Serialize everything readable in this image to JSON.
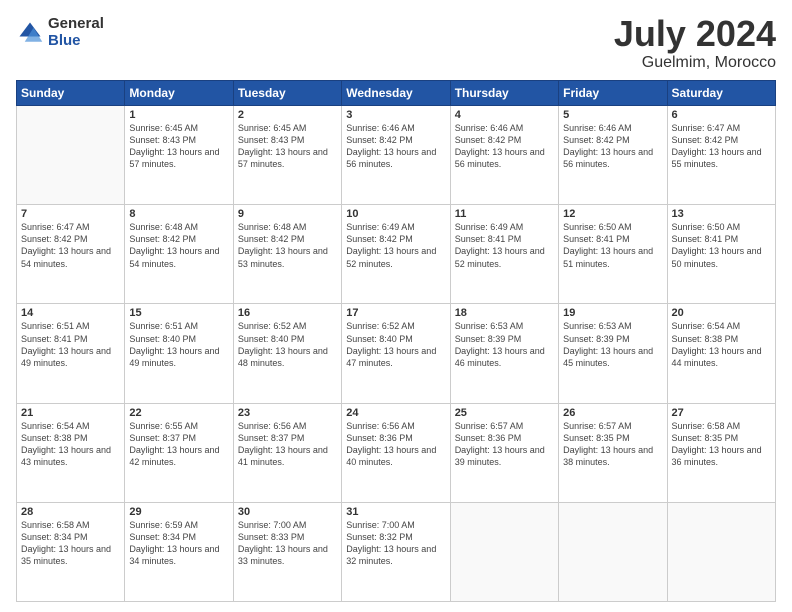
{
  "logo": {
    "general": "General",
    "blue": "Blue"
  },
  "title": {
    "month_year": "July 2024",
    "location": "Guelmim, Morocco"
  },
  "weekdays": [
    "Sunday",
    "Monday",
    "Tuesday",
    "Wednesday",
    "Thursday",
    "Friday",
    "Saturday"
  ],
  "weeks": [
    [
      {
        "day": "",
        "sunrise": "",
        "sunset": "",
        "daylight": ""
      },
      {
        "day": "1",
        "sunrise": "Sunrise: 6:45 AM",
        "sunset": "Sunset: 8:43 PM",
        "daylight": "Daylight: 13 hours and 57 minutes."
      },
      {
        "day": "2",
        "sunrise": "Sunrise: 6:45 AM",
        "sunset": "Sunset: 8:43 PM",
        "daylight": "Daylight: 13 hours and 57 minutes."
      },
      {
        "day": "3",
        "sunrise": "Sunrise: 6:46 AM",
        "sunset": "Sunset: 8:42 PM",
        "daylight": "Daylight: 13 hours and 56 minutes."
      },
      {
        "day": "4",
        "sunrise": "Sunrise: 6:46 AM",
        "sunset": "Sunset: 8:42 PM",
        "daylight": "Daylight: 13 hours and 56 minutes."
      },
      {
        "day": "5",
        "sunrise": "Sunrise: 6:46 AM",
        "sunset": "Sunset: 8:42 PM",
        "daylight": "Daylight: 13 hours and 56 minutes."
      },
      {
        "day": "6",
        "sunrise": "Sunrise: 6:47 AM",
        "sunset": "Sunset: 8:42 PM",
        "daylight": "Daylight: 13 hours and 55 minutes."
      }
    ],
    [
      {
        "day": "7",
        "sunrise": "Sunrise: 6:47 AM",
        "sunset": "Sunset: 8:42 PM",
        "daylight": "Daylight: 13 hours and 54 minutes."
      },
      {
        "day": "8",
        "sunrise": "Sunrise: 6:48 AM",
        "sunset": "Sunset: 8:42 PM",
        "daylight": "Daylight: 13 hours and 54 minutes."
      },
      {
        "day": "9",
        "sunrise": "Sunrise: 6:48 AM",
        "sunset": "Sunset: 8:42 PM",
        "daylight": "Daylight: 13 hours and 53 minutes."
      },
      {
        "day": "10",
        "sunrise": "Sunrise: 6:49 AM",
        "sunset": "Sunset: 8:42 PM",
        "daylight": "Daylight: 13 hours and 52 minutes."
      },
      {
        "day": "11",
        "sunrise": "Sunrise: 6:49 AM",
        "sunset": "Sunset: 8:41 PM",
        "daylight": "Daylight: 13 hours and 52 minutes."
      },
      {
        "day": "12",
        "sunrise": "Sunrise: 6:50 AM",
        "sunset": "Sunset: 8:41 PM",
        "daylight": "Daylight: 13 hours and 51 minutes."
      },
      {
        "day": "13",
        "sunrise": "Sunrise: 6:50 AM",
        "sunset": "Sunset: 8:41 PM",
        "daylight": "Daylight: 13 hours and 50 minutes."
      }
    ],
    [
      {
        "day": "14",
        "sunrise": "Sunrise: 6:51 AM",
        "sunset": "Sunset: 8:41 PM",
        "daylight": "Daylight: 13 hours and 49 minutes."
      },
      {
        "day": "15",
        "sunrise": "Sunrise: 6:51 AM",
        "sunset": "Sunset: 8:40 PM",
        "daylight": "Daylight: 13 hours and 49 minutes."
      },
      {
        "day": "16",
        "sunrise": "Sunrise: 6:52 AM",
        "sunset": "Sunset: 8:40 PM",
        "daylight": "Daylight: 13 hours and 48 minutes."
      },
      {
        "day": "17",
        "sunrise": "Sunrise: 6:52 AM",
        "sunset": "Sunset: 8:40 PM",
        "daylight": "Daylight: 13 hours and 47 minutes."
      },
      {
        "day": "18",
        "sunrise": "Sunrise: 6:53 AM",
        "sunset": "Sunset: 8:39 PM",
        "daylight": "Daylight: 13 hours and 46 minutes."
      },
      {
        "day": "19",
        "sunrise": "Sunrise: 6:53 AM",
        "sunset": "Sunset: 8:39 PM",
        "daylight": "Daylight: 13 hours and 45 minutes."
      },
      {
        "day": "20",
        "sunrise": "Sunrise: 6:54 AM",
        "sunset": "Sunset: 8:38 PM",
        "daylight": "Daylight: 13 hours and 44 minutes."
      }
    ],
    [
      {
        "day": "21",
        "sunrise": "Sunrise: 6:54 AM",
        "sunset": "Sunset: 8:38 PM",
        "daylight": "Daylight: 13 hours and 43 minutes."
      },
      {
        "day": "22",
        "sunrise": "Sunrise: 6:55 AM",
        "sunset": "Sunset: 8:37 PM",
        "daylight": "Daylight: 13 hours and 42 minutes."
      },
      {
        "day": "23",
        "sunrise": "Sunrise: 6:56 AM",
        "sunset": "Sunset: 8:37 PM",
        "daylight": "Daylight: 13 hours and 41 minutes."
      },
      {
        "day": "24",
        "sunrise": "Sunrise: 6:56 AM",
        "sunset": "Sunset: 8:36 PM",
        "daylight": "Daylight: 13 hours and 40 minutes."
      },
      {
        "day": "25",
        "sunrise": "Sunrise: 6:57 AM",
        "sunset": "Sunset: 8:36 PM",
        "daylight": "Daylight: 13 hours and 39 minutes."
      },
      {
        "day": "26",
        "sunrise": "Sunrise: 6:57 AM",
        "sunset": "Sunset: 8:35 PM",
        "daylight": "Daylight: 13 hours and 38 minutes."
      },
      {
        "day": "27",
        "sunrise": "Sunrise: 6:58 AM",
        "sunset": "Sunset: 8:35 PM",
        "daylight": "Daylight: 13 hours and 36 minutes."
      }
    ],
    [
      {
        "day": "28",
        "sunrise": "Sunrise: 6:58 AM",
        "sunset": "Sunset: 8:34 PM",
        "daylight": "Daylight: 13 hours and 35 minutes."
      },
      {
        "day": "29",
        "sunrise": "Sunrise: 6:59 AM",
        "sunset": "Sunset: 8:34 PM",
        "daylight": "Daylight: 13 hours and 34 minutes."
      },
      {
        "day": "30",
        "sunrise": "Sunrise: 7:00 AM",
        "sunset": "Sunset: 8:33 PM",
        "daylight": "Daylight: 13 hours and 33 minutes."
      },
      {
        "day": "31",
        "sunrise": "Sunrise: 7:00 AM",
        "sunset": "Sunset: 8:32 PM",
        "daylight": "Daylight: 13 hours and 32 minutes."
      },
      {
        "day": "",
        "sunrise": "",
        "sunset": "",
        "daylight": ""
      },
      {
        "day": "",
        "sunrise": "",
        "sunset": "",
        "daylight": ""
      },
      {
        "day": "",
        "sunrise": "",
        "sunset": "",
        "daylight": ""
      }
    ]
  ]
}
